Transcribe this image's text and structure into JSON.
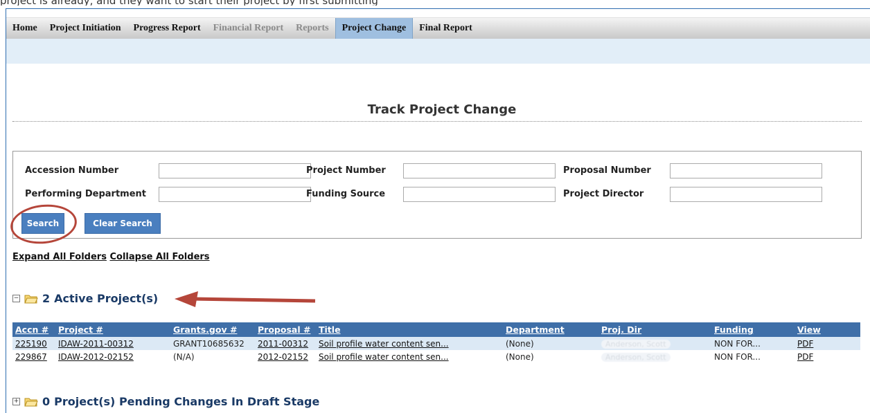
{
  "top_caption": "project is already, and they want to start their project by first submitting",
  "nav": {
    "items": [
      {
        "label": "Home",
        "state": "normal"
      },
      {
        "label": "Project Initiation",
        "state": "normal"
      },
      {
        "label": "Progress Report",
        "state": "normal"
      },
      {
        "label": "Financial Report",
        "state": "disabled"
      },
      {
        "label": "Reports",
        "state": "disabled"
      },
      {
        "label": "Project Change",
        "state": "active"
      },
      {
        "label": "Final Report",
        "state": "normal"
      }
    ]
  },
  "page": {
    "title": "Track Project Change"
  },
  "search": {
    "labels": {
      "accession": "Accession Number",
      "project_number": "Project Number",
      "proposal_number": "Proposal Number",
      "performing_department": "Performing Department",
      "funding_source": "Funding Source",
      "project_director": "Project Director"
    },
    "values": {
      "accession": "",
      "project_number": "",
      "proposal_number": "",
      "performing_department": "",
      "funding_source": "",
      "project_director": ""
    },
    "search_label": "Search",
    "clear_label": "Clear Search"
  },
  "folders": {
    "expand_all": "Expand All Folders",
    "collapse_all": "Collapse All Folders",
    "active": {
      "count": "2",
      "label": "Active Project(s)",
      "toggle": "−"
    },
    "pending": {
      "count": "0",
      "label": "Project(s) Pending Changes In Draft Stage",
      "toggle": "+"
    }
  },
  "table": {
    "headers": [
      "Accn #",
      "Project #",
      "Grants.gov #",
      "Proposal #",
      "Title",
      "Department",
      "Proj. Dir",
      "Funding",
      "View"
    ],
    "rows": [
      {
        "accn": "225190",
        "project": "IDAW-2011-00312",
        "grants": "GRANT10685632",
        "proposal": "2011-00312",
        "title": "Soil profile water content sen...",
        "department": "(None)",
        "projdir": "Anderson, Scott",
        "funding": "NON FOR...",
        "view": "PDF"
      },
      {
        "accn": "229867",
        "project": "IDAW-2012-02152",
        "grants": "(N/A)",
        "proposal": "2012-02152",
        "title": "Soil profile water content sen...",
        "department": "(None)",
        "projdir": "Anderson, Scott",
        "funding": "NON FOR...",
        "view": "PDF"
      }
    ]
  },
  "colors": {
    "accent": "#3f6fa8",
    "annotation": "#b5463a",
    "nav_active": "#9fbfe0"
  }
}
